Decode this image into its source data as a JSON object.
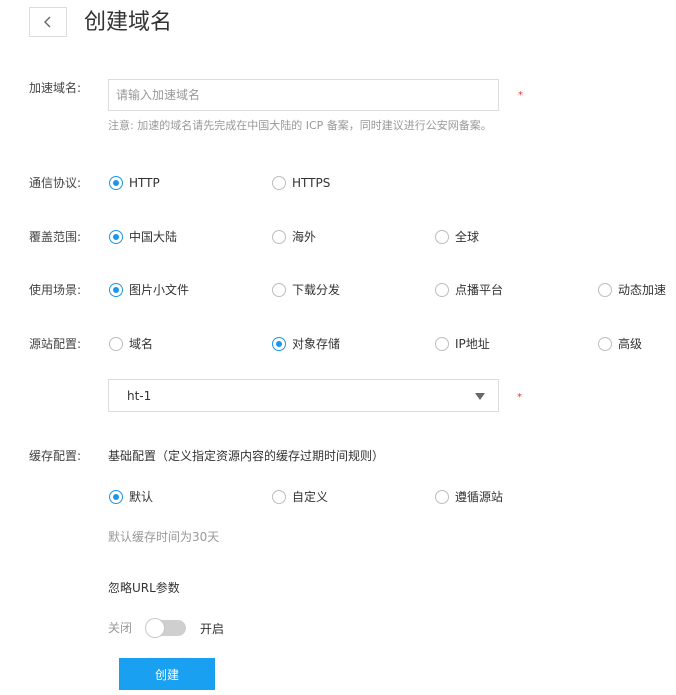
{
  "header": {
    "title": "创建域名"
  },
  "domain": {
    "label": "加速域名:",
    "placeholder": "请输入加速域名",
    "value": "",
    "required_mark": "*",
    "note": "注意: 加速的域名请先完成在中国大陆的 ICP 备案，同时建议进行公安网备案。"
  },
  "protocol": {
    "label": "通信协议:",
    "options": [
      {
        "label": "HTTP",
        "checked": true
      },
      {
        "label": "HTTPS",
        "checked": false
      }
    ]
  },
  "coverage": {
    "label": "覆盖范围:",
    "options": [
      {
        "label": "中国大陆",
        "checked": true
      },
      {
        "label": "海外",
        "checked": false
      },
      {
        "label": "全球",
        "checked": false
      }
    ]
  },
  "scenario": {
    "label": "使用场景:",
    "options": [
      {
        "label": "图片小文件",
        "checked": true
      },
      {
        "label": "下载分发",
        "checked": false
      },
      {
        "label": "点播平台",
        "checked": false
      },
      {
        "label": "动态加速",
        "checked": false
      }
    ]
  },
  "origin": {
    "label": "源站配置:",
    "options": [
      {
        "label": "域名",
        "checked": false
      },
      {
        "label": "对象存储",
        "checked": true
      },
      {
        "label": "IP地址",
        "checked": false
      },
      {
        "label": "高级",
        "checked": false
      }
    ],
    "bucket_value": "ht-1",
    "required_mark": "*"
  },
  "cache": {
    "label": "缓存配置:",
    "subtitle": "基础配置（定义指定资源内容的缓存过期时间规则）",
    "options": [
      {
        "label": "默认",
        "checked": true
      },
      {
        "label": "自定义",
        "checked": false
      },
      {
        "label": "遵循源站",
        "checked": false
      }
    ],
    "default_note": "默认缓存时间为30天",
    "ignore_url_params_label": "忽略URL参数",
    "toggle_off_label": "关闭",
    "toggle_on_label": "开启",
    "ignore_url_params_enabled": false
  },
  "actions": {
    "create_label": "创建"
  },
  "colors": {
    "accent": "#1aa0f0",
    "radio_checked": "#1c96e8",
    "required": "#e53935"
  }
}
